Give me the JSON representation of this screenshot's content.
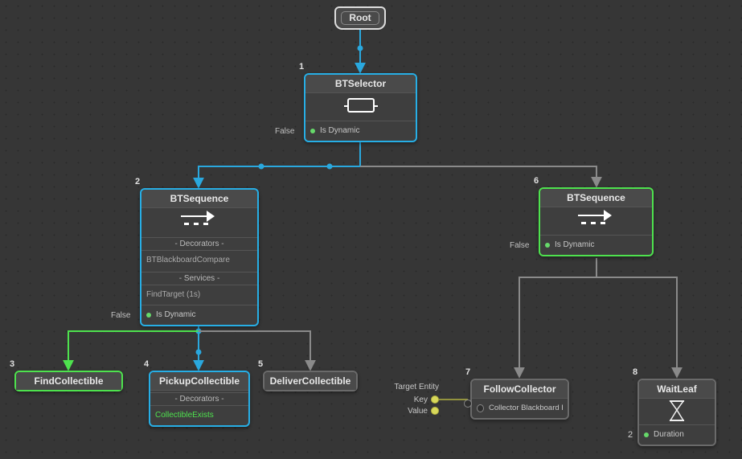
{
  "root": {
    "label": "Root"
  },
  "n1": {
    "index": "1",
    "title": "BTSelector",
    "false_label": "False",
    "is_dynamic": "Is Dynamic"
  },
  "n2": {
    "index": "2",
    "title": "BTSequence",
    "decorators_header": "- Decorators -",
    "decorator1": "BTBlackboardCompare",
    "services_header": "- Services -",
    "service1": "FindTarget (1s)",
    "false_label": "False",
    "is_dynamic": "Is Dynamic"
  },
  "n6": {
    "index": "6",
    "title": "BTSequence",
    "false_label": "False",
    "is_dynamic": "Is Dynamic"
  },
  "n3": {
    "index": "3",
    "title": "FindCollectible"
  },
  "n4": {
    "index": "4",
    "title": "PickupCollectible",
    "decorators_header": "- Decorators -",
    "decorator1": "CollectibleExists"
  },
  "n5": {
    "index": "5",
    "title": "DeliverCollectible"
  },
  "n7": {
    "index": "7",
    "title": "FollowCollector",
    "subtitle": "Collector Blackboard Ref"
  },
  "n8": {
    "index": "8",
    "title": "WaitLeaf",
    "duration_label": "Duration",
    "left_num": "2"
  },
  "mini": {
    "title": "Target Entity",
    "key": "Key",
    "value": "Value"
  }
}
